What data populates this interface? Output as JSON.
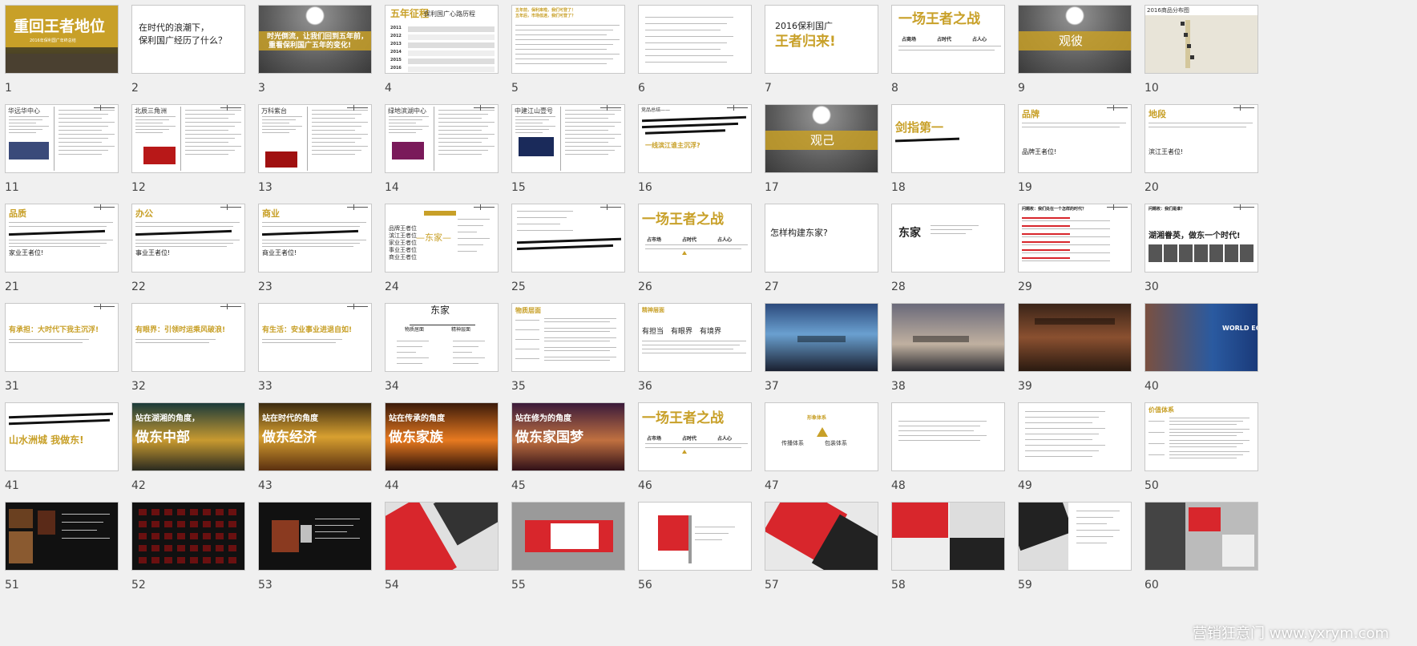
{
  "slides": [
    {
      "n": "1",
      "title": "重回王者地位",
      "sub": "2016年保利国广年终总结"
    },
    {
      "n": "2",
      "l1": "在时代的浪潮下，",
      "l2": "保利国广经历了什么？"
    },
    {
      "n": "3",
      "l1": "时光倒流，让我们回到五年前，",
      "l2": "重看保利国广五年的变化!"
    },
    {
      "n": "4",
      "title": "五年征程",
      "sub": "保利国广心路历程",
      "years": [
        "2011",
        "2012",
        "2013",
        "2014",
        "2015",
        "2016"
      ]
    },
    {
      "n": "5",
      "l1": "五年前，保利来啦，我们可登了！",
      "l2": "五年后，市场低迷，我们可登了？"
    },
    {
      "n": "6"
    },
    {
      "n": "7",
      "l1": "2016保利国广",
      "l2": "王者归来!"
    },
    {
      "n": "8",
      "title": "一场王者之战",
      "cols": [
        "占商场",
        "占时代",
        "占人心"
      ]
    },
    {
      "n": "9",
      "title": "观彼"
    },
    {
      "n": "10",
      "title": "2016商品分布图"
    },
    {
      "n": "11",
      "title": "华远华中心"
    },
    {
      "n": "12",
      "title": "北辰三角洲"
    },
    {
      "n": "13",
      "title": "万科紫台"
    },
    {
      "n": "14",
      "title": "绿地滨湖中心"
    },
    {
      "n": "15",
      "title": "中建江山壹号"
    },
    {
      "n": "16",
      "title": "竞品总结——",
      "foot": "一线滨江谁主沉浮?"
    },
    {
      "n": "17",
      "title": "观己"
    },
    {
      "n": "18",
      "title": "剑指第一"
    },
    {
      "n": "19",
      "title": "品牌",
      "foot": "品牌王者位!"
    },
    {
      "n": "20",
      "title": "地段",
      "foot": "滨江王者位!"
    },
    {
      "n": "21",
      "title": "品质",
      "foot": "家业王者位!"
    },
    {
      "n": "22",
      "title": "办公",
      "foot": "事业王者位!"
    },
    {
      "n": "23",
      "title": "商业",
      "foot": "商业王者位!"
    },
    {
      "n": "24",
      "list": [
        "品牌王者位",
        "滨江王者位",
        "家业王者位",
        "事业王者位",
        "商业王者位"
      ],
      "center": "—东家—"
    },
    {
      "n": "25"
    },
    {
      "n": "26",
      "title": "一场王者之战",
      "cols": [
        "占市场",
        "占时代",
        "占人心"
      ]
    },
    {
      "n": "27",
      "l1": "怎样构建东家?"
    },
    {
      "n": "28",
      "title": "东家"
    },
    {
      "n": "29",
      "title": "问题枚：我们处在一个怎样的时代？"
    },
    {
      "n": "30",
      "title": "问题枚：我们是谁？",
      "l1": "湖湘眷英，做东一个时代!"
    },
    {
      "n": "31",
      "title": "有承担：大时代下我主沉浮!"
    },
    {
      "n": "32",
      "title": "有眼界：引领时运乘风破浪!"
    },
    {
      "n": "33",
      "title": "有生活：安业事业进退自如!"
    },
    {
      "n": "34",
      "title": "东家",
      "cols": [
        "物质居面",
        "精神层面"
      ]
    },
    {
      "n": "35",
      "title": "物质层面"
    },
    {
      "n": "36",
      "title": "精神层面",
      "cols": [
        "有担当",
        "有眼界",
        "有境界"
      ]
    },
    {
      "n": "37"
    },
    {
      "n": "38"
    },
    {
      "n": "39"
    },
    {
      "n": "40",
      "logo": "WORLD ECONOMIC FORUM"
    },
    {
      "n": "41",
      "foot": "山水洲城 我做东!"
    },
    {
      "n": "42",
      "l1": "站在湖湘的角度，",
      "l2": "做东中部"
    },
    {
      "n": "43",
      "l1": "站在时代的角度",
      "l2": "做东经济"
    },
    {
      "n": "44",
      "l1": "站在传承的角度",
      "l2": "做东家族"
    },
    {
      "n": "45",
      "l1": "站在修为的角度",
      "l2": "做东家国梦"
    },
    {
      "n": "46",
      "title": "一场王者之战",
      "cols": [
        "占市场",
        "占时代",
        "占人心"
      ]
    },
    {
      "n": "47",
      "title": "形象体系",
      "cols": [
        "传播体系",
        "包装体系"
      ]
    },
    {
      "n": "48"
    },
    {
      "n": "49"
    },
    {
      "n": "50",
      "title": "价值体系"
    },
    {
      "n": "51"
    },
    {
      "n": "52"
    },
    {
      "n": "53"
    },
    {
      "n": "54"
    },
    {
      "n": "55"
    },
    {
      "n": "56"
    },
    {
      "n": "57"
    },
    {
      "n": "58"
    },
    {
      "n": "59"
    },
    {
      "n": "60"
    }
  ],
  "watermark": "营销狂意门 www.yxrym.com",
  "colors": {
    "gold": "#c8a028",
    "red": "#d8262c",
    "dark": "#111111",
    "bg": "#f0f0f0"
  }
}
